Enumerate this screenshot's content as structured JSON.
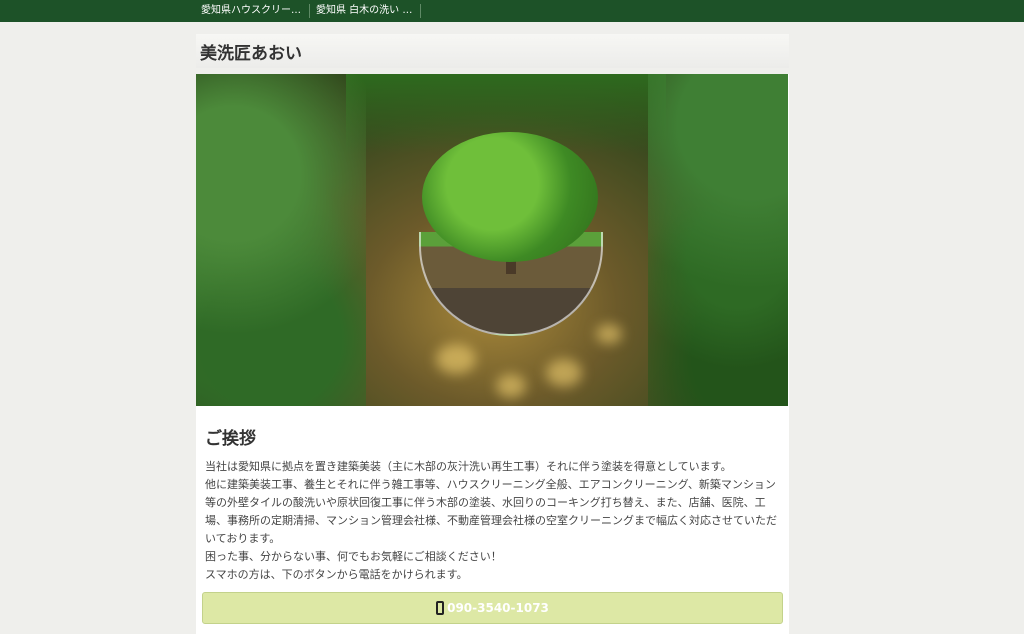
{
  "topbar": {
    "tabs": [
      {
        "label": "愛知県ハウスクリー…"
      },
      {
        "label": "愛知県 白木の洗い …"
      }
    ]
  },
  "header": {
    "site_title": "美洗匠あおい"
  },
  "main": {
    "heading": "ご挨拶",
    "paragraph_lines": [
      "当社は愛知県に拠点を置き建築美装（主に木部の灰汁洗い再生工事）それに伴う塗装を得意としています。",
      "他に建築美装工事、養生とそれに伴う雑工事等、ハウスクリーニング全般、エアコンクリーニング、新築マンション等の外壁タイルの酸洗いや原状回復工事に伴う木部の塗装、水回りのコーキング打ち替え、また、店舗、医院、工場、事務所の定期清掃、マンション管理会社様、不動産管理会社様の空室クリーニングまで幅広く対応させていただいております。",
      "困った事、分からない事、何でもお気軽にご相談ください！",
      "スマホの方は、下のボタンから電話をかけられます。"
    ],
    "call_button": {
      "label": "090-3540-1073",
      "icon": "phone-icon"
    }
  },
  "colors": {
    "topbar": "#1d5228",
    "call_button_bg": "#dde8a5"
  }
}
